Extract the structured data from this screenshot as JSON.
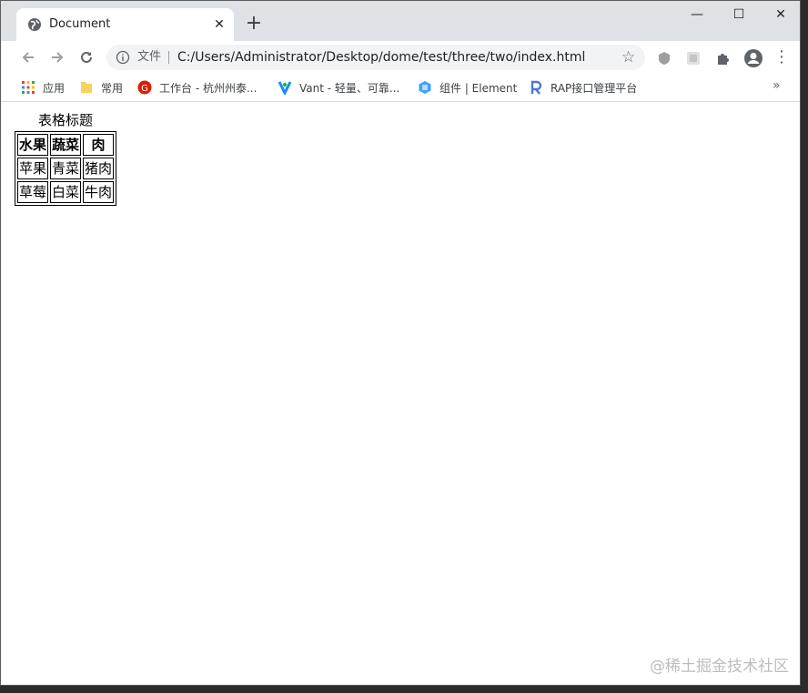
{
  "browser": {
    "tab": {
      "title": "Document",
      "close": "✕"
    },
    "new_tab": "+",
    "window_controls": {
      "minimize": "—",
      "maximize": "☐",
      "close": "✕"
    }
  },
  "toolbar": {
    "scheme_label": "文件",
    "url": "C:/Users/Administrator/Desktop/dome/test/three/two/index.html"
  },
  "bookmarks": [
    {
      "label": "应用",
      "icon": "apps-grid-icon"
    },
    {
      "label": "常用",
      "icon": "folder-icon"
    },
    {
      "label": "工作台 - 杭州州泰...",
      "icon": "red-logo-icon"
    },
    {
      "label": "Vant - 轻量、可靠...",
      "icon": "vant-logo-icon"
    },
    {
      "label": "组件 | Element",
      "icon": "element-logo-icon"
    },
    {
      "label": "RAP接口管理平台",
      "icon": "rap-logo-icon"
    }
  ],
  "page": {
    "table": {
      "caption": "表格标题",
      "headers": [
        "水果",
        "蔬菜",
        "肉"
      ],
      "rows": [
        [
          "苹果",
          "青菜",
          "猪肉"
        ],
        [
          "草莓",
          "白菜",
          "牛肉"
        ]
      ]
    }
  },
  "watermark": "@稀土掘金技术社区",
  "colors": {
    "tabstrip": "#dee1e6",
    "omnibox": "#f1f3f4"
  }
}
